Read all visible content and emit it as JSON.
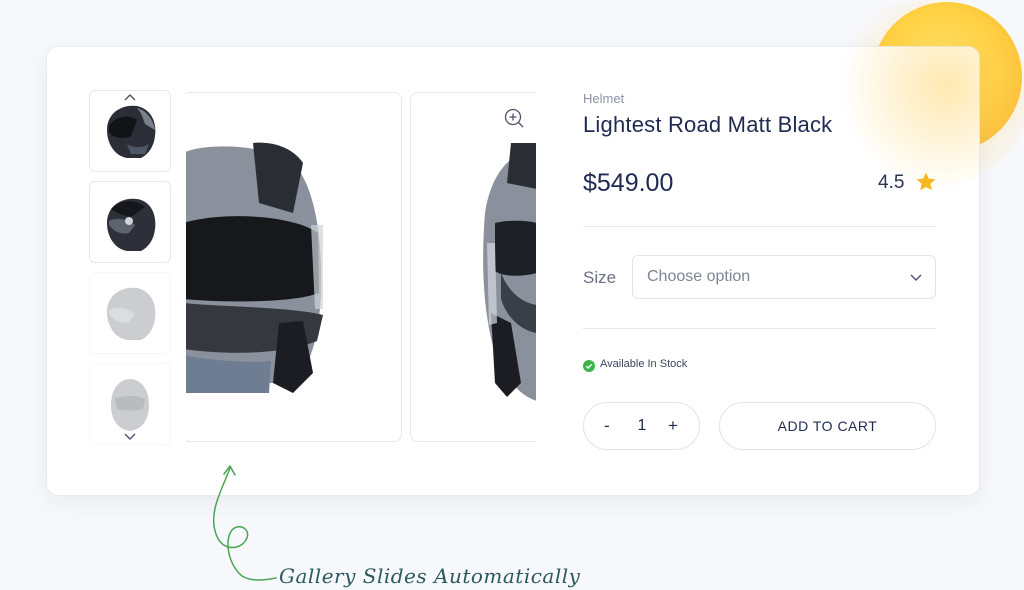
{
  "product": {
    "category": "Helmet",
    "title": "Lightest Road Matt Black",
    "price": "$549.00",
    "rating": "4.5",
    "rating_icon": "star-icon",
    "size_label": "Size",
    "size_placeholder": "Choose option",
    "stock_status": "Available In Stock",
    "quantity": "1",
    "qty_minus": "-",
    "qty_plus": "+",
    "add_to_cart_label": "ADD TO CART"
  },
  "gallery": {
    "thumbnails": [
      "helmet-side-dark",
      "helmet-side-visor-up",
      "helmet-side-light",
      "helmet-front-light"
    ],
    "caption": "Gallery Slides Automatically"
  },
  "colors": {
    "accent_sun": "#ffcf3a",
    "title_navy": "#1f2a52",
    "stock_green": "#3bb54a",
    "rating_star": "#f5b820",
    "caption_arrow": "#49a553"
  }
}
